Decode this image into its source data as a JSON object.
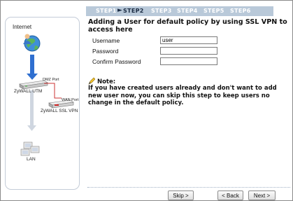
{
  "steps": [
    "STEP1",
    "STEP2",
    "STEP3",
    "STEP4",
    "STEP5",
    "STEP6"
  ],
  "active_step": 1,
  "diagram": {
    "internet_label": "Internet",
    "dmz_port_label": "DMZ Port",
    "utm_label": "ZyWALL UTM",
    "wan_port_label": "WAN Port",
    "ssl_vpn_label": "ZyWALL SSL VPN",
    "lan_label": "LAN"
  },
  "main": {
    "title": "Adding a User for default policy by using SSL VPN to access here",
    "form": {
      "username_label": "Username",
      "username_value": "user",
      "password_label": "Password",
      "password_value": "",
      "confirm_label": "Confirm Password",
      "confirm_value": ""
    },
    "note_heading": "Note:",
    "note_text": "If you have created users already and don't want to add new user now, you can skip this step to keep users no change in the default policy."
  },
  "buttons": {
    "skip": "Skip >",
    "back": "< Back",
    "next": "Next >"
  }
}
